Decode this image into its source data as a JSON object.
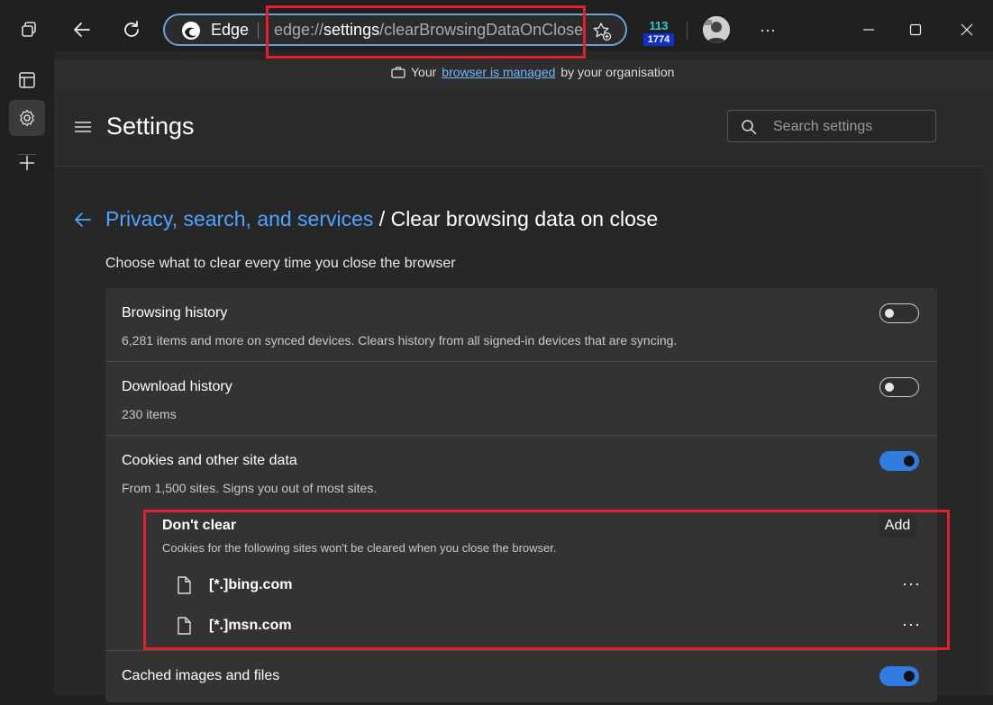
{
  "browser": {
    "address_brand": "Edge",
    "url_prefix": "edge://",
    "url_path": "settings",
    "url_suffix": "/clearBrowsingDataOnClose",
    "extension_badge": {
      "top": "113",
      "bottom": "1774"
    },
    "more_label": "···"
  },
  "managed_banner": {
    "prefix": "Your",
    "link": "browser is managed",
    "suffix": "by your organisation"
  },
  "header": {
    "title": "Settings",
    "search_placeholder": "Search settings"
  },
  "breadcrumb": {
    "parent": "Privacy, search, and services",
    "separator": " / ",
    "current": "Clear browsing data on close"
  },
  "intro": "Choose what to clear every time you close the browser",
  "options": [
    {
      "title": "Browsing history",
      "subtitle": "6,281 items and more on synced devices. Clears history from all signed-in devices that are syncing.",
      "enabled": false
    },
    {
      "title": "Download history",
      "subtitle": "230 items",
      "enabled": false
    },
    {
      "title": "Cookies and other site data",
      "subtitle": "From 1,500 sites. Signs you out of most sites.",
      "enabled": true
    },
    {
      "title": "Cached images and files",
      "subtitle": "",
      "enabled": true
    }
  ],
  "dont_clear": {
    "title": "Don't clear",
    "subtitle": "Cookies for the following sites won't be cleared when you close the browser.",
    "add_label": "Add",
    "sites": [
      {
        "name": "[*.]bing.com",
        "more": "···"
      },
      {
        "name": "[*.]msn.com",
        "more": "···"
      }
    ]
  },
  "colors": {
    "highlight": "#e0202a",
    "accent": "#2f7de0",
    "link": "#4fa3ff"
  }
}
